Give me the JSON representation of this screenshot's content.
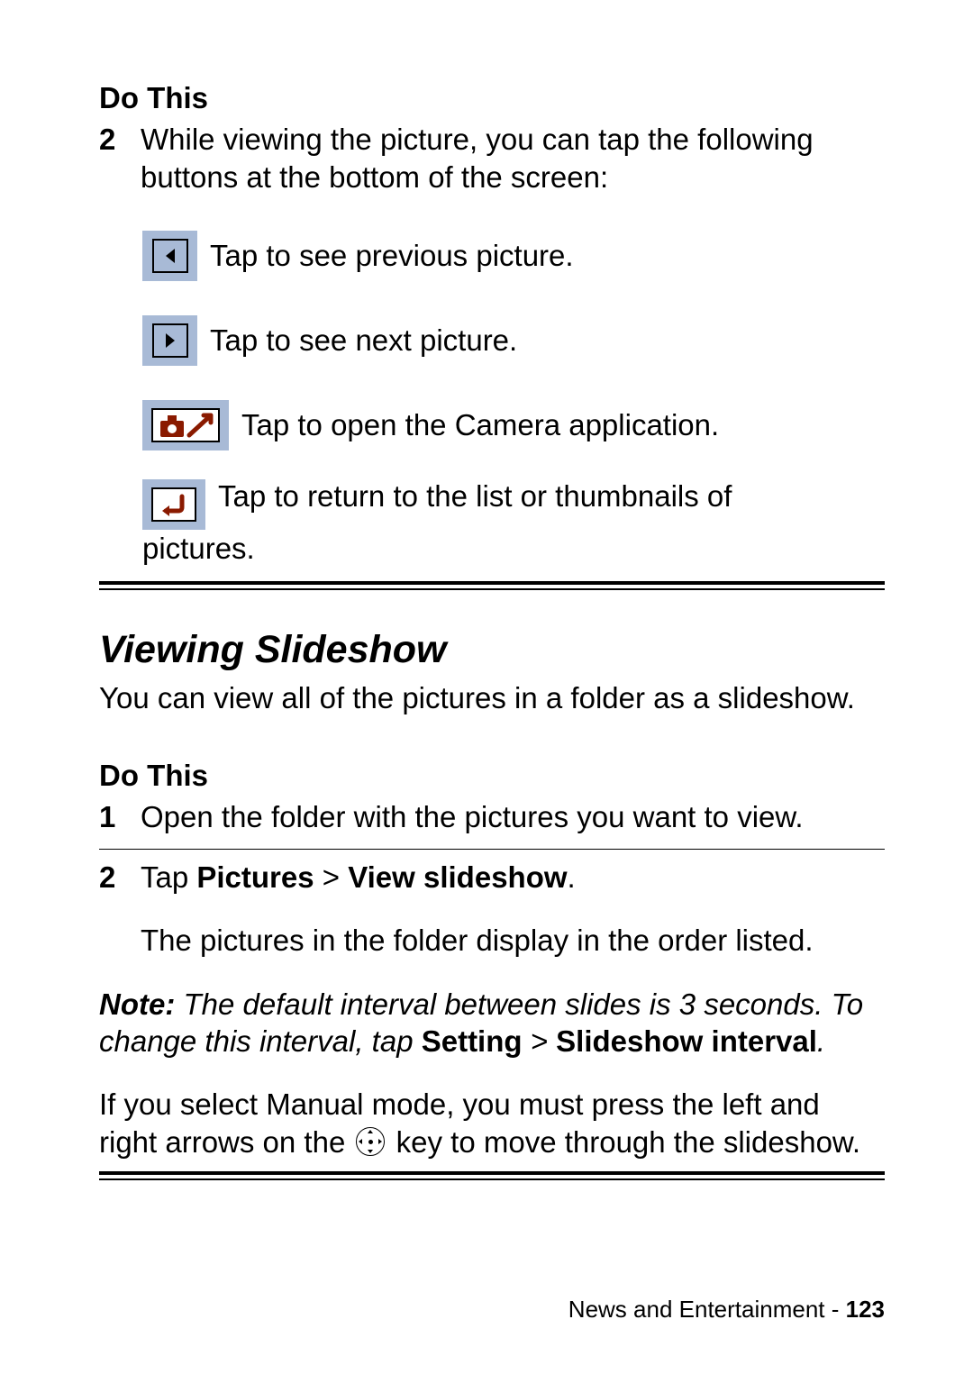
{
  "section1": {
    "do_this": "Do This",
    "step2_num": "2",
    "step2_text": "While viewing the picture, you can tap the following buttons at the bottom of the screen:",
    "prev_desc": "Tap to see previous picture.",
    "next_desc": "Tap to see next picture.",
    "camera_desc": "Tap to open the Camera application.",
    "return_desc_line1": "Tap to return to the list or thumbnails of",
    "return_desc_line2": "pictures."
  },
  "section2": {
    "title": "Viewing Slideshow",
    "intro": "You can view all of the pictures in a folder as a slideshow.",
    "do_this": "Do This",
    "step1_num": "1",
    "step1_text": "Open the folder with the pictures you want to view.",
    "step2_num": "2",
    "step2_prefix": "Tap ",
    "step2_bold1": "Pictures",
    "step2_gt": " > ",
    "step2_bold2": "View slideshow",
    "step2_suffix": ".",
    "step2_follow": "The pictures in the folder display in the order listed.",
    "note_label": "Note:",
    "note_body1": "The default interval between slides is 3 seconds. To change this interval, tap ",
    "note_bold1": "Setting",
    "note_gt": " > ",
    "note_bold2": "Slideshow interval",
    "note_suffix": ".",
    "manual_pre": "If you select Manual mode, you must press the left and right arrows on the ",
    "manual_post": " key to move through the slideshow."
  },
  "footer": {
    "section": "News and Entertainment - ",
    "page": "123"
  }
}
